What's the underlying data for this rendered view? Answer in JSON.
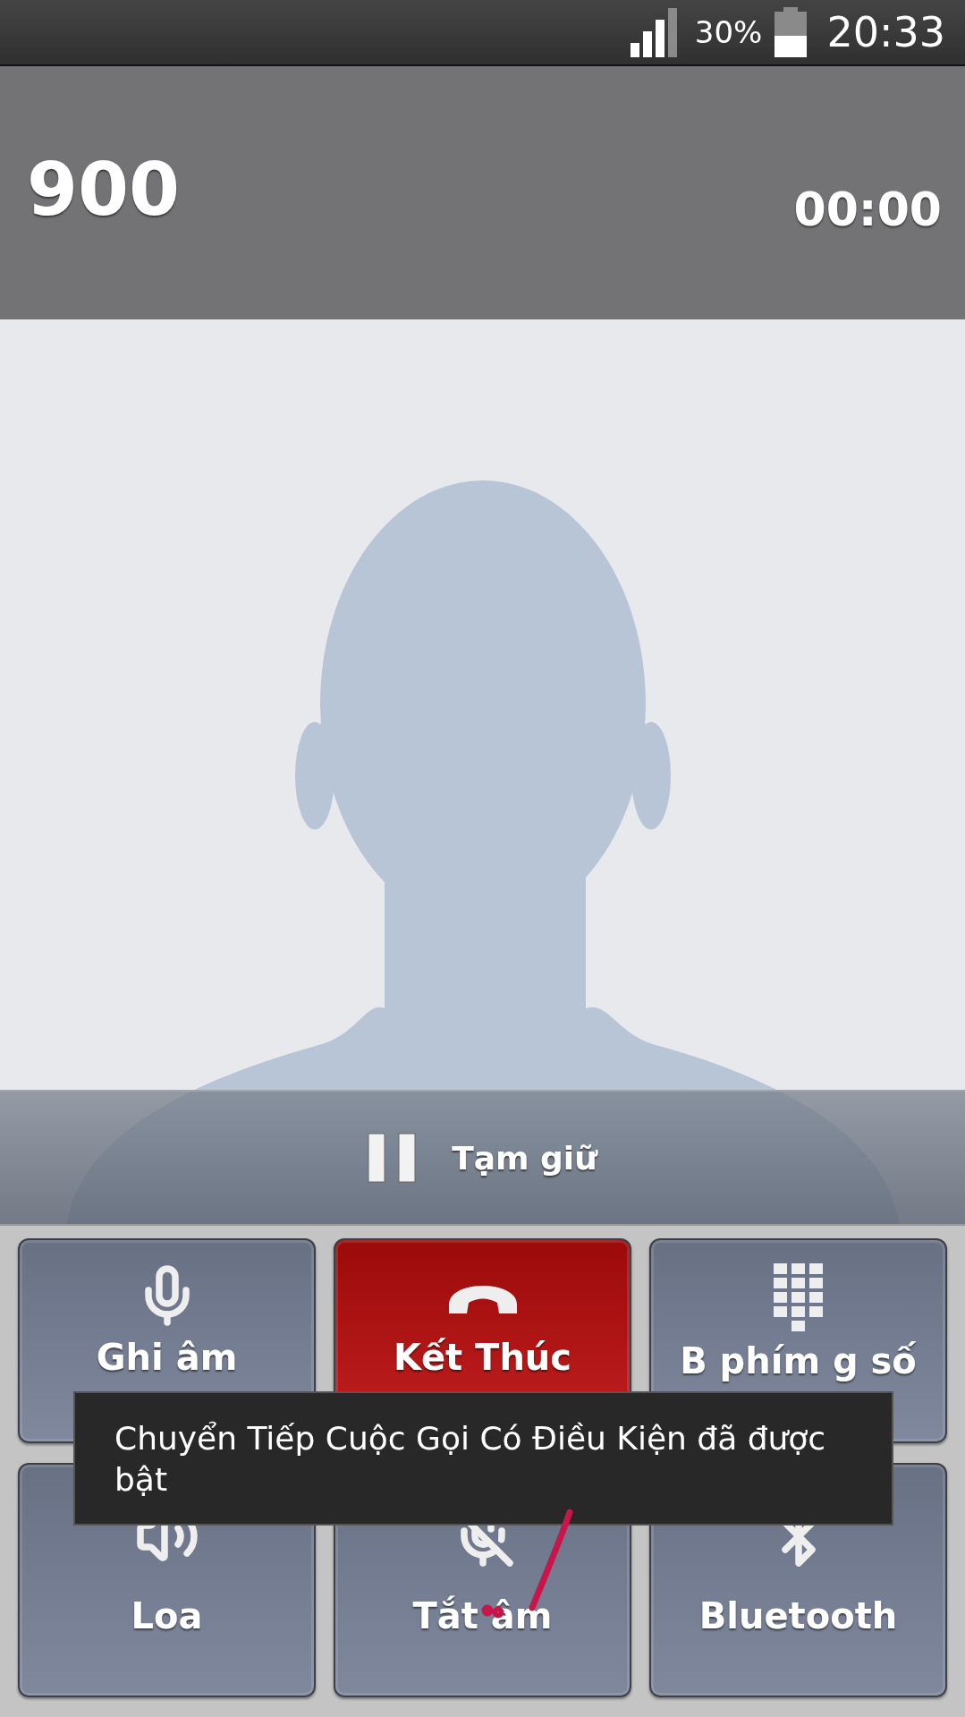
{
  "status_bar": {
    "battery": "30%",
    "time": "20:33"
  },
  "call": {
    "number": "900",
    "timer": "00:00"
  },
  "hold_bar": {
    "label": "Tạm giữ"
  },
  "buttons": [
    {
      "kind": "record",
      "label": "Ghi âm"
    },
    {
      "kind": "end",
      "label": "Kết Thúc"
    },
    {
      "kind": "keypad",
      "label": "B phím g số"
    },
    {
      "kind": "speaker",
      "label": "Loa"
    },
    {
      "kind": "mute",
      "label": "Tắt âm"
    },
    {
      "kind": "bluetooth",
      "label": "Bluetooth"
    }
  ],
  "toast": {
    "message": "Chuyển Tiếp Cuộc Gọi Có Điều Kiện đã được bật"
  }
}
